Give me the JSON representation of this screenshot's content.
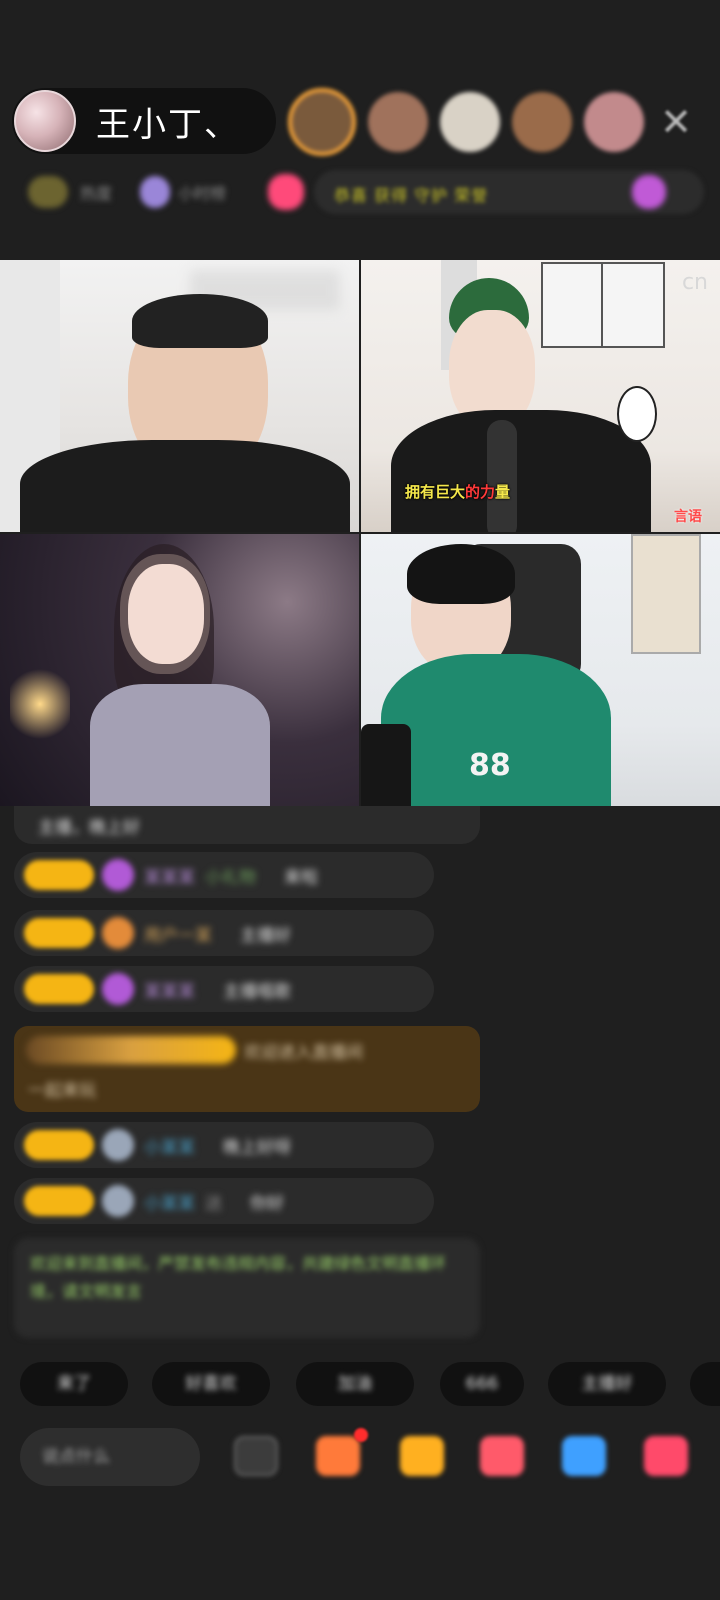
{
  "host": {
    "name": "王小丁、",
    "avatar_icon": "host-avatar"
  },
  "viewers": [
    {
      "color": "#7a5a3c",
      "top": true
    },
    {
      "color": "#a0725c",
      "top": false
    },
    {
      "color": "#d9d2c6",
      "top": false
    },
    {
      "color": "#9a6b4a",
      "top": false
    },
    {
      "color": "#c28a8c",
      "top": false
    }
  ],
  "close_icon": "close-icon",
  "info_bar": {
    "item1": "热度",
    "item2": "小时榜",
    "banner": "恭喜 获得 守护 荣誉"
  },
  "video": {
    "cell2_watermark": "cn",
    "cell2_subtitle_a": "拥有巨大",
    "cell2_subtitle_b": "的力",
    "cell2_subtitle_c": "量",
    "cell2_name": "言语",
    "cell4_jersey": "88"
  },
  "chat": {
    "top_line": "主播，晚上好",
    "lines": [
      {
        "user": "某某某",
        "extra": "小礼物",
        "msg": "来啦",
        "gem": "#b15ad6",
        "ucolor": "#b58ad6"
      },
      {
        "user": "用户一某",
        "extra": "",
        "msg": "主播好",
        "gem": "#e38b3a",
        "ucolor": "#d4a45a"
      },
      {
        "user": "某某某",
        "extra": "",
        "msg": "主播唱歌",
        "gem": "#b15ad6",
        "ucolor": "#b58ad6"
      },
      {
        "user": "小某某",
        "extra": "",
        "msg": "晚上好呀",
        "gem": "#9aa6b8",
        "ucolor": "#4aa0c8"
      },
      {
        "user": "小某某",
        "extra": "送",
        "msg": "你好",
        "gem": "#9aa6b8",
        "ucolor": "#4aa0c8"
      }
    ],
    "special_line1": "欢迎进入直播间",
    "special_line2": "一起来玩",
    "notice": "欢迎来到直播间，严禁发布违规内容，共建绿色文明直播环境，请文明发言"
  },
  "quick_replies": [
    "来了",
    "好喜欢",
    "加油",
    "666",
    "主播好"
  ],
  "toolbar": {
    "say_placeholder": "说点什么",
    "tools": [
      {
        "icon": "emoji-icon",
        "color": "#3c3c3c"
      },
      {
        "icon": "gift-box-icon",
        "color": "#ff7a3a"
      },
      {
        "icon": "gift-bag-icon",
        "color": "#ffb020"
      },
      {
        "icon": "red-packet-icon",
        "color": "#ff5a6a"
      },
      {
        "icon": "game-icon",
        "color": "#3fa0ff"
      },
      {
        "icon": "more-icon",
        "color": "#ff4a6a"
      }
    ]
  }
}
